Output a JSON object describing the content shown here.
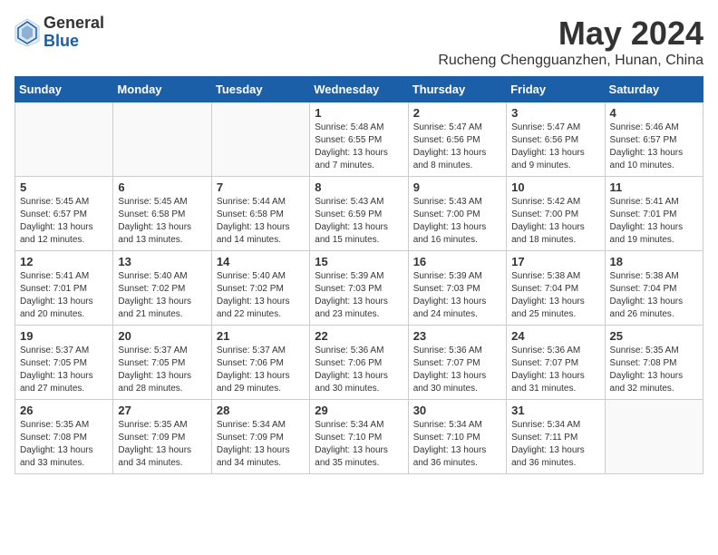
{
  "header": {
    "logo_general": "General",
    "logo_blue": "Blue",
    "month_year": "May 2024",
    "location": "Rucheng Chengguanzhen, Hunan, China"
  },
  "days_of_week": [
    "Sunday",
    "Monday",
    "Tuesday",
    "Wednesday",
    "Thursday",
    "Friday",
    "Saturday"
  ],
  "weeks": [
    [
      {
        "day": "",
        "sunrise": "",
        "sunset": "",
        "daylight": ""
      },
      {
        "day": "",
        "sunrise": "",
        "sunset": "",
        "daylight": ""
      },
      {
        "day": "",
        "sunrise": "",
        "sunset": "",
        "daylight": ""
      },
      {
        "day": "1",
        "sunrise": "Sunrise: 5:48 AM",
        "sunset": "Sunset: 6:55 PM",
        "daylight": "Daylight: 13 hours and 7 minutes."
      },
      {
        "day": "2",
        "sunrise": "Sunrise: 5:47 AM",
        "sunset": "Sunset: 6:56 PM",
        "daylight": "Daylight: 13 hours and 8 minutes."
      },
      {
        "day": "3",
        "sunrise": "Sunrise: 5:47 AM",
        "sunset": "Sunset: 6:56 PM",
        "daylight": "Daylight: 13 hours and 9 minutes."
      },
      {
        "day": "4",
        "sunrise": "Sunrise: 5:46 AM",
        "sunset": "Sunset: 6:57 PM",
        "daylight": "Daylight: 13 hours and 10 minutes."
      }
    ],
    [
      {
        "day": "5",
        "sunrise": "Sunrise: 5:45 AM",
        "sunset": "Sunset: 6:57 PM",
        "daylight": "Daylight: 13 hours and 12 minutes."
      },
      {
        "day": "6",
        "sunrise": "Sunrise: 5:45 AM",
        "sunset": "Sunset: 6:58 PM",
        "daylight": "Daylight: 13 hours and 13 minutes."
      },
      {
        "day": "7",
        "sunrise": "Sunrise: 5:44 AM",
        "sunset": "Sunset: 6:58 PM",
        "daylight": "Daylight: 13 hours and 14 minutes."
      },
      {
        "day": "8",
        "sunrise": "Sunrise: 5:43 AM",
        "sunset": "Sunset: 6:59 PM",
        "daylight": "Daylight: 13 hours and 15 minutes."
      },
      {
        "day": "9",
        "sunrise": "Sunrise: 5:43 AM",
        "sunset": "Sunset: 7:00 PM",
        "daylight": "Daylight: 13 hours and 16 minutes."
      },
      {
        "day": "10",
        "sunrise": "Sunrise: 5:42 AM",
        "sunset": "Sunset: 7:00 PM",
        "daylight": "Daylight: 13 hours and 18 minutes."
      },
      {
        "day": "11",
        "sunrise": "Sunrise: 5:41 AM",
        "sunset": "Sunset: 7:01 PM",
        "daylight": "Daylight: 13 hours and 19 minutes."
      }
    ],
    [
      {
        "day": "12",
        "sunrise": "Sunrise: 5:41 AM",
        "sunset": "Sunset: 7:01 PM",
        "daylight": "Daylight: 13 hours and 20 minutes."
      },
      {
        "day": "13",
        "sunrise": "Sunrise: 5:40 AM",
        "sunset": "Sunset: 7:02 PM",
        "daylight": "Daylight: 13 hours and 21 minutes."
      },
      {
        "day": "14",
        "sunrise": "Sunrise: 5:40 AM",
        "sunset": "Sunset: 7:02 PM",
        "daylight": "Daylight: 13 hours and 22 minutes."
      },
      {
        "day": "15",
        "sunrise": "Sunrise: 5:39 AM",
        "sunset": "Sunset: 7:03 PM",
        "daylight": "Daylight: 13 hours and 23 minutes."
      },
      {
        "day": "16",
        "sunrise": "Sunrise: 5:39 AM",
        "sunset": "Sunset: 7:03 PM",
        "daylight": "Daylight: 13 hours and 24 minutes."
      },
      {
        "day": "17",
        "sunrise": "Sunrise: 5:38 AM",
        "sunset": "Sunset: 7:04 PM",
        "daylight": "Daylight: 13 hours and 25 minutes."
      },
      {
        "day": "18",
        "sunrise": "Sunrise: 5:38 AM",
        "sunset": "Sunset: 7:04 PM",
        "daylight": "Daylight: 13 hours and 26 minutes."
      }
    ],
    [
      {
        "day": "19",
        "sunrise": "Sunrise: 5:37 AM",
        "sunset": "Sunset: 7:05 PM",
        "daylight": "Daylight: 13 hours and 27 minutes."
      },
      {
        "day": "20",
        "sunrise": "Sunrise: 5:37 AM",
        "sunset": "Sunset: 7:05 PM",
        "daylight": "Daylight: 13 hours and 28 minutes."
      },
      {
        "day": "21",
        "sunrise": "Sunrise: 5:37 AM",
        "sunset": "Sunset: 7:06 PM",
        "daylight": "Daylight: 13 hours and 29 minutes."
      },
      {
        "day": "22",
        "sunrise": "Sunrise: 5:36 AM",
        "sunset": "Sunset: 7:06 PM",
        "daylight": "Daylight: 13 hours and 30 minutes."
      },
      {
        "day": "23",
        "sunrise": "Sunrise: 5:36 AM",
        "sunset": "Sunset: 7:07 PM",
        "daylight": "Daylight: 13 hours and 30 minutes."
      },
      {
        "day": "24",
        "sunrise": "Sunrise: 5:36 AM",
        "sunset": "Sunset: 7:07 PM",
        "daylight": "Daylight: 13 hours and 31 minutes."
      },
      {
        "day": "25",
        "sunrise": "Sunrise: 5:35 AM",
        "sunset": "Sunset: 7:08 PM",
        "daylight": "Daylight: 13 hours and 32 minutes."
      }
    ],
    [
      {
        "day": "26",
        "sunrise": "Sunrise: 5:35 AM",
        "sunset": "Sunset: 7:08 PM",
        "daylight": "Daylight: 13 hours and 33 minutes."
      },
      {
        "day": "27",
        "sunrise": "Sunrise: 5:35 AM",
        "sunset": "Sunset: 7:09 PM",
        "daylight": "Daylight: 13 hours and 34 minutes."
      },
      {
        "day": "28",
        "sunrise": "Sunrise: 5:34 AM",
        "sunset": "Sunset: 7:09 PM",
        "daylight": "Daylight: 13 hours and 34 minutes."
      },
      {
        "day": "29",
        "sunrise": "Sunrise: 5:34 AM",
        "sunset": "Sunset: 7:10 PM",
        "daylight": "Daylight: 13 hours and 35 minutes."
      },
      {
        "day": "30",
        "sunrise": "Sunrise: 5:34 AM",
        "sunset": "Sunset: 7:10 PM",
        "daylight": "Daylight: 13 hours and 36 minutes."
      },
      {
        "day": "31",
        "sunrise": "Sunrise: 5:34 AM",
        "sunset": "Sunset: 7:11 PM",
        "daylight": "Daylight: 13 hours and 36 minutes."
      },
      {
        "day": "",
        "sunrise": "",
        "sunset": "",
        "daylight": ""
      }
    ]
  ]
}
